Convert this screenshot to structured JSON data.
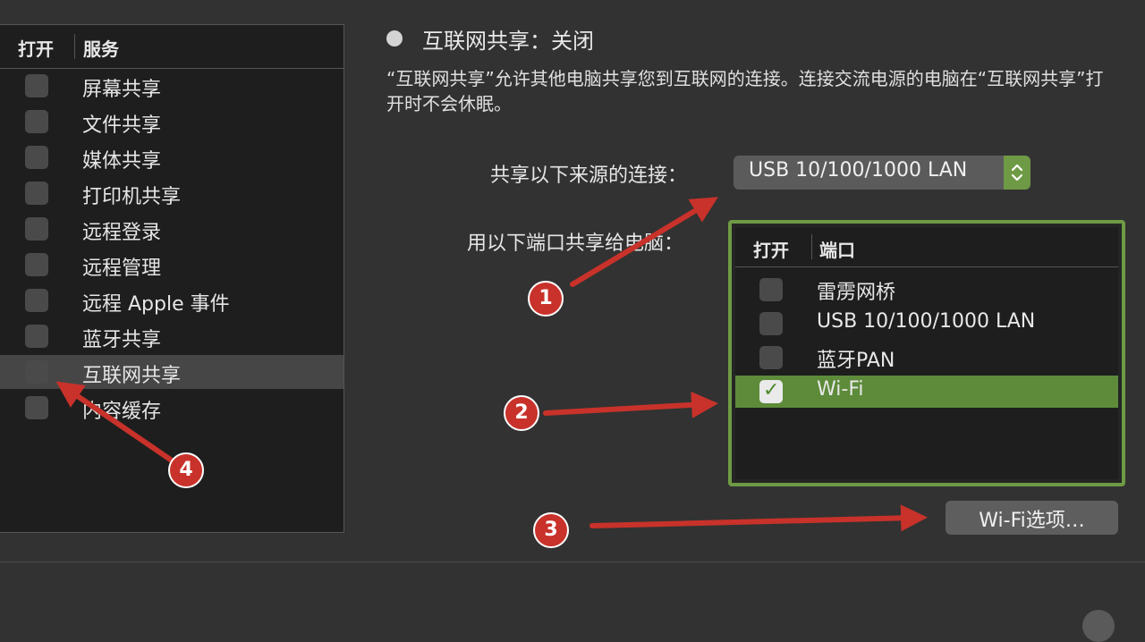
{
  "services": {
    "header": {
      "on": "打开",
      "service": "服务"
    },
    "items": [
      {
        "label": "屏幕共享",
        "checked": false,
        "selected": false
      },
      {
        "label": "文件共享",
        "checked": false,
        "selected": false
      },
      {
        "label": "媒体共享",
        "checked": false,
        "selected": false
      },
      {
        "label": "打印机共享",
        "checked": false,
        "selected": false
      },
      {
        "label": "远程登录",
        "checked": false,
        "selected": false
      },
      {
        "label": "远程管理",
        "checked": false,
        "selected": false
      },
      {
        "label": "远程 Apple 事件",
        "checked": false,
        "selected": false
      },
      {
        "label": "蓝牙共享",
        "checked": false,
        "selected": false
      },
      {
        "label": "互联网共享",
        "checked": false,
        "selected": true
      },
      {
        "label": "内容缓存",
        "checked": false,
        "selected": false
      }
    ]
  },
  "sharing": {
    "status": "互联网共享：关闭",
    "description": "“互联网共享”允许其他电脑共享您到互联网的连接。连接交流电源的电脑在“互联网共享”打开时不会休眠。",
    "source_label": "共享以下来源的连接：",
    "source_value": "USB 10/100/1000 LAN",
    "ports_label": "用以下端口共享给电脑：",
    "ports_header": {
      "on": "打开",
      "port": "端口"
    },
    "ports": [
      {
        "label": "雷雳网桥",
        "checked": false,
        "selected": false
      },
      {
        "label": "USB 10/100/1000 LAN",
        "checked": false,
        "selected": false
      },
      {
        "label": "蓝牙PAN",
        "checked": false,
        "selected": false
      },
      {
        "label": "Wi-Fi",
        "checked": true,
        "selected": true
      }
    ],
    "wifi_options_label": "Wi-Fi选项…"
  },
  "annotations": {
    "badges": [
      "1",
      "2",
      "3",
      "4"
    ],
    "color": "#c8322a"
  },
  "colors": {
    "accent_green": "#6f9a45",
    "selected_row_green": "#5d8b3a"
  }
}
